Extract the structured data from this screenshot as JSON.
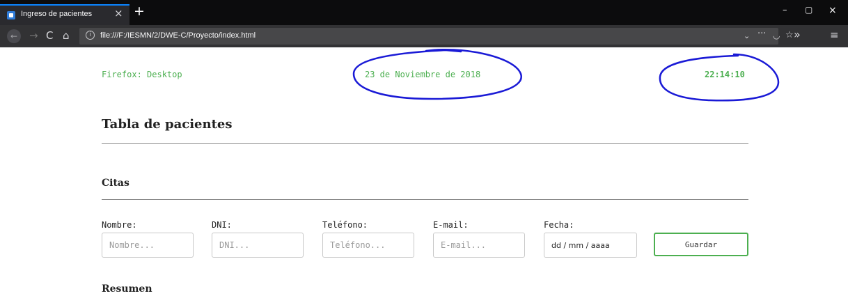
{
  "browser": {
    "tab": {
      "title": "Ingreso de pacientes",
      "close_icon": "×"
    },
    "new_tab_icon": "+",
    "window_controls": {
      "minimize": "–",
      "maximize": "▢",
      "close": "×"
    },
    "nav": {
      "back": "←",
      "forward": "→",
      "reload": "C",
      "home": "⌂"
    },
    "url": "file:///F:/IESMN/2/DWE-C/Proyecto/index.html",
    "url_actions": {
      "dropdown": "⌄",
      "more": "···",
      "pocket": "◡",
      "star": "☆",
      "overflow": "»",
      "menu": "≡"
    }
  },
  "header": {
    "browser_info": "Firefox: Desktop",
    "date": "23 de Noviembre de 2018",
    "time": "22:14:10"
  },
  "page": {
    "title": "Tabla de pacientes",
    "citas_heading": "Citas",
    "resumen_heading": "Resumen"
  },
  "form": {
    "nombre": {
      "label": "Nombre:",
      "placeholder": "Nombre..."
    },
    "dni": {
      "label": "DNI:",
      "placeholder": "DNI..."
    },
    "telefono": {
      "label": "Teléfono:",
      "placeholder": "Teléfono..."
    },
    "email": {
      "label": "E-mail:",
      "placeholder": "E-mail..."
    },
    "fecha": {
      "label": "Fecha:",
      "value": "dd / mm / aaaa"
    },
    "save_label": "Guardar"
  },
  "colors": {
    "accent_green": "#4caf50",
    "annotation_blue": "#1a1ad6",
    "tab_highlight": "#0a84ff"
  }
}
